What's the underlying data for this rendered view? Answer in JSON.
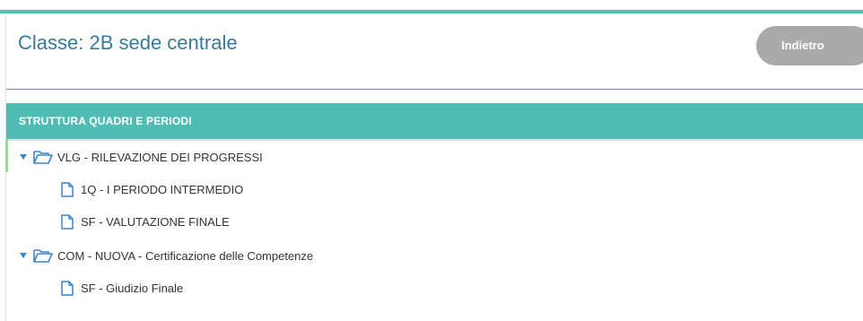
{
  "header": {
    "title": "Classe: 2B sede centrale",
    "back_label": "Indietro"
  },
  "section": {
    "title": "STRUTTURA QUADRI E PERIODI"
  },
  "tree": [
    {
      "label": "VLG - RILEVAZIONE DEI PROGRESSI",
      "icon": "folder-open-icon",
      "expanded": true,
      "children": [
        {
          "label": "1Q - I PERIODO INTERMEDIO",
          "icon": "file-icon"
        },
        {
          "label": "SF - VALUTAZIONE FINALE",
          "icon": "file-icon"
        }
      ]
    },
    {
      "label": "COM - NUOVA - Certificazione delle Competenze",
      "icon": "folder-open-icon",
      "expanded": true,
      "children": [
        {
          "label": "SF - Giudizio Finale",
          "icon": "file-icon"
        }
      ]
    }
  ],
  "colors": {
    "accent_teal": "#4fbdb3",
    "title_blue": "#3a7a96",
    "icon_blue": "#3d85c6",
    "button_gray": "#aaaaaa"
  }
}
